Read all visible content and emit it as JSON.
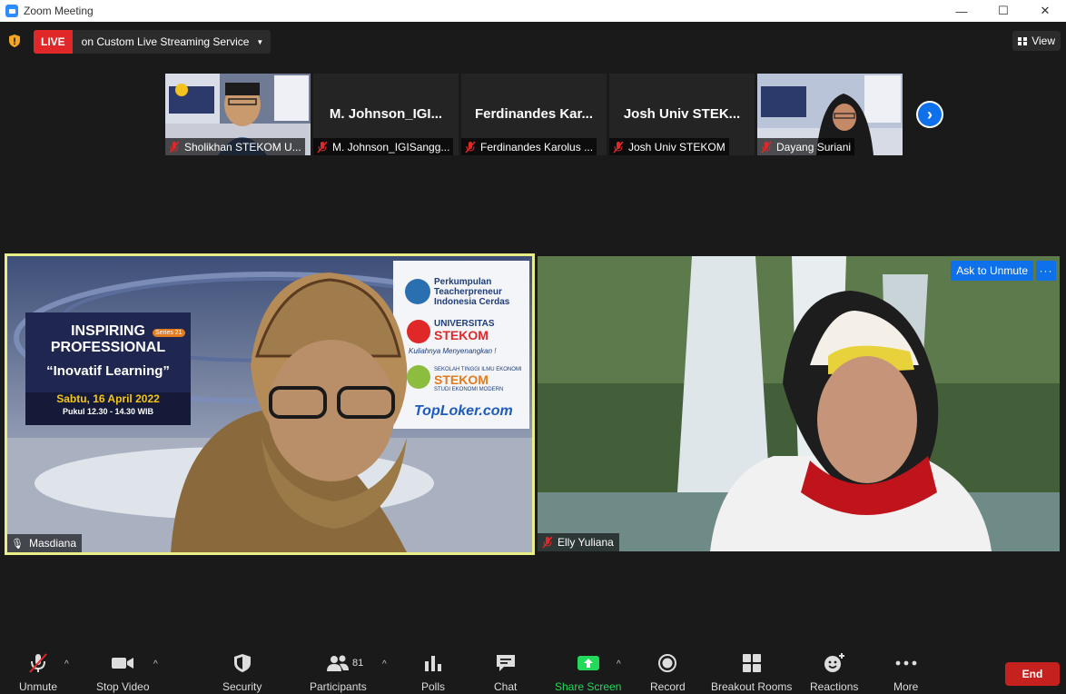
{
  "window": {
    "title": "Zoom Meeting",
    "minimize": "—",
    "maximize": "☐",
    "close": "✕"
  },
  "topbar": {
    "live_badge": "LIVE",
    "live_service": "on Custom Live Streaming Service",
    "view_label": "View"
  },
  "strip": [
    {
      "label": "Sholikhan STEKOM U...",
      "name_center": "",
      "has_video": true
    },
    {
      "label": "M. Johnson_IGISangg...",
      "name_center": "M. Johnson_IGI...",
      "has_video": false
    },
    {
      "label": "Ferdinandes Karolus ...",
      "name_center": "Ferdinandes  Kar...",
      "has_video": false
    },
    {
      "label": "Josh Univ STEKOM",
      "name_center": "Josh Univ STEK...",
      "has_video": false
    },
    {
      "label": "Dayang Suriani",
      "name_center": "",
      "has_video": true
    }
  ],
  "tiles": {
    "left": {
      "name": "Masdiana",
      "banner_line1": "INSPIRING",
      "banner_line2": "PROFESSIONAL",
      "banner_series": "Series 21",
      "banner_title": "“Inovatif Learning”",
      "banner_date": "Sabtu, 16 April 2022",
      "banner_time": "Pukul 12.30 - 14.30 WIB",
      "logo1_a": "Perkumpulan",
      "logo1_b": "Teacherpreneur",
      "logo1_c": "Indonesia Cerdas",
      "logo2_a": "UNIVERSITAS",
      "logo2_b": "STEKOM",
      "logo2_c": "Kuliahnya Menyenangkan !",
      "logo3_a": "SEKOLAH TINGGI ILMU EKONOMI",
      "logo3_b": "STEKOM",
      "logo3_c": "STUDI EKONOMI MODERN",
      "logo4": "TopLoker.com"
    },
    "right": {
      "name": "Elly Yuliana",
      "ask_unmute": "Ask to Unmute",
      "more": "···"
    }
  },
  "toolbar": {
    "unmute": "Unmute",
    "stop_video": "Stop Video",
    "security": "Security",
    "participants": "Participants",
    "participants_count": "81",
    "polls": "Polls",
    "chat": "Chat",
    "share_screen": "Share Screen",
    "record": "Record",
    "breakout_rooms": "Breakout Rooms",
    "reactions": "Reactions",
    "more": "More",
    "end": "End"
  },
  "colors": {
    "accent": "#0e71eb",
    "live_red": "#e02828",
    "end_red": "#c5211f",
    "share_green": "#23d959",
    "active_speaker": "#e9ef86"
  }
}
